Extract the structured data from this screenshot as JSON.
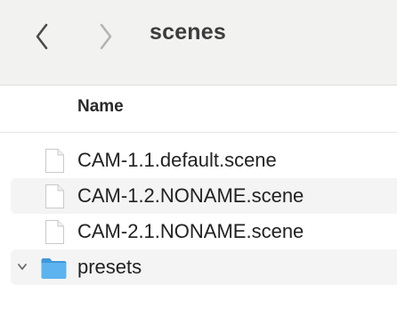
{
  "toolbar": {
    "title": "scenes",
    "back_icon": "chevron-left-icon",
    "forward_icon": "chevron-right-icon"
  },
  "columns": {
    "name": "Name"
  },
  "items": [
    {
      "label": "CAM-1.1.default.scene",
      "kind": "file",
      "icon": "document-icon"
    },
    {
      "label": "CAM-1.2.NONAME.scene",
      "kind": "file",
      "icon": "document-icon"
    },
    {
      "label": "CAM-2.1.NONAME.scene",
      "kind": "file",
      "icon": "document-icon"
    },
    {
      "label": "presets",
      "kind": "folder",
      "icon": "folder-icon",
      "expanded": false
    }
  ],
  "colors": {
    "toolbar_bg": "#f2f2f1",
    "folder_blue": "#4aa3e6",
    "stripe": "#f4f4f4"
  }
}
